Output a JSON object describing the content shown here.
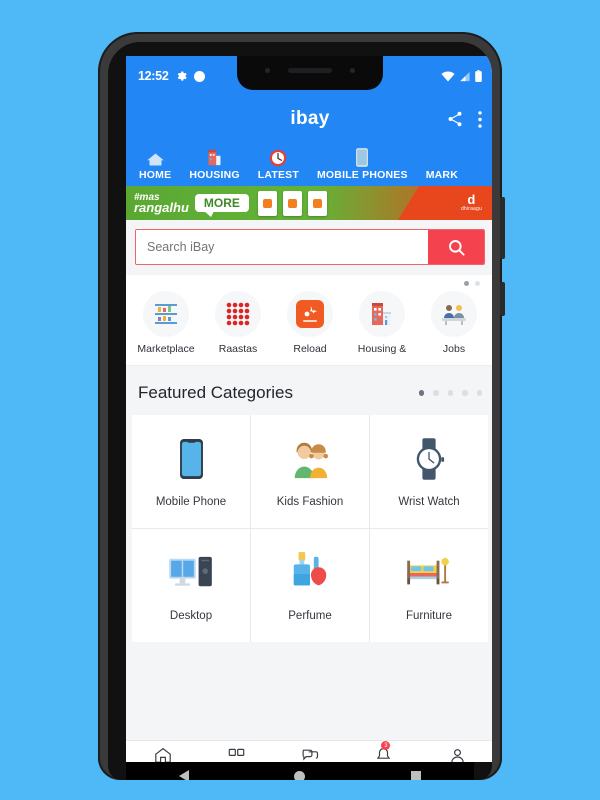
{
  "status_bar": {
    "time": "12:52",
    "left_icons": [
      "gear-icon",
      "circle-icon"
    ],
    "right_icons": [
      "wifi-icon",
      "cellular-signal-icon",
      "battery-icon"
    ]
  },
  "app_bar": {
    "title": "ibay",
    "share_label": "share-icon",
    "overflow_label": "more-vertical-icon"
  },
  "tabs": [
    {
      "label": "HOME",
      "icon": "home-icon"
    },
    {
      "label": "HOUSING",
      "icon": "building-icon"
    },
    {
      "label": "LATEST",
      "icon": "clock-icon"
    },
    {
      "label": "MOBILE PHONES",
      "icon": "phone-icon"
    },
    {
      "label": "MARK",
      "icon": "market-icon"
    }
  ],
  "banner": {
    "hashtag_line1": "#mas",
    "hashtag_line2": "rangalhu",
    "more_label": "MORE",
    "brand": "dhiraagu",
    "brand_mark": "d"
  },
  "search": {
    "placeholder": "Search iBay",
    "value": "",
    "button_icon": "search-icon"
  },
  "quick_access": {
    "dots_total": 2,
    "dots_active": 1,
    "items": [
      {
        "label": "Marketplace",
        "icon": "shelf-icon"
      },
      {
        "label": "Raastas",
        "icon": "grid-dots-icon"
      },
      {
        "label": "Reload",
        "icon": "dhiraagu-hand-icon"
      },
      {
        "label": "Housing &",
        "icon": "buildings-icon"
      },
      {
        "label": "Jobs",
        "icon": "people-desk-icon"
      }
    ]
  },
  "featured": {
    "title": "Featured Categories",
    "dots_total": 5,
    "dots_active": 1,
    "items": [
      {
        "label": "Mobile Phone",
        "icon": "smartphone-icon"
      },
      {
        "label": "Kids Fashion",
        "icon": "children-icon"
      },
      {
        "label": "Wrist Watch",
        "icon": "watch-icon"
      },
      {
        "label": "Desktop",
        "icon": "computer-icon"
      },
      {
        "label": "Perfume",
        "icon": "perfume-icon"
      },
      {
        "label": "Furniture",
        "icon": "bed-icon"
      }
    ]
  },
  "bottom_nav": {
    "items": [
      {
        "icon": "home-nav-icon"
      },
      {
        "icon": "categories-nav-icon"
      },
      {
        "icon": "chat-nav-icon"
      },
      {
        "icon": "notifications-nav-icon"
      },
      {
        "icon": "account-nav-icon"
      }
    ],
    "badge_text": "3"
  },
  "android_nav": {
    "back": "back-triangle-icon",
    "home": "home-circle-icon",
    "recents": "recents-square-icon"
  },
  "colors": {
    "brand_blue": "#2286f4",
    "accent_red": "#f4434f",
    "page_bg": "#4fb8f7"
  }
}
